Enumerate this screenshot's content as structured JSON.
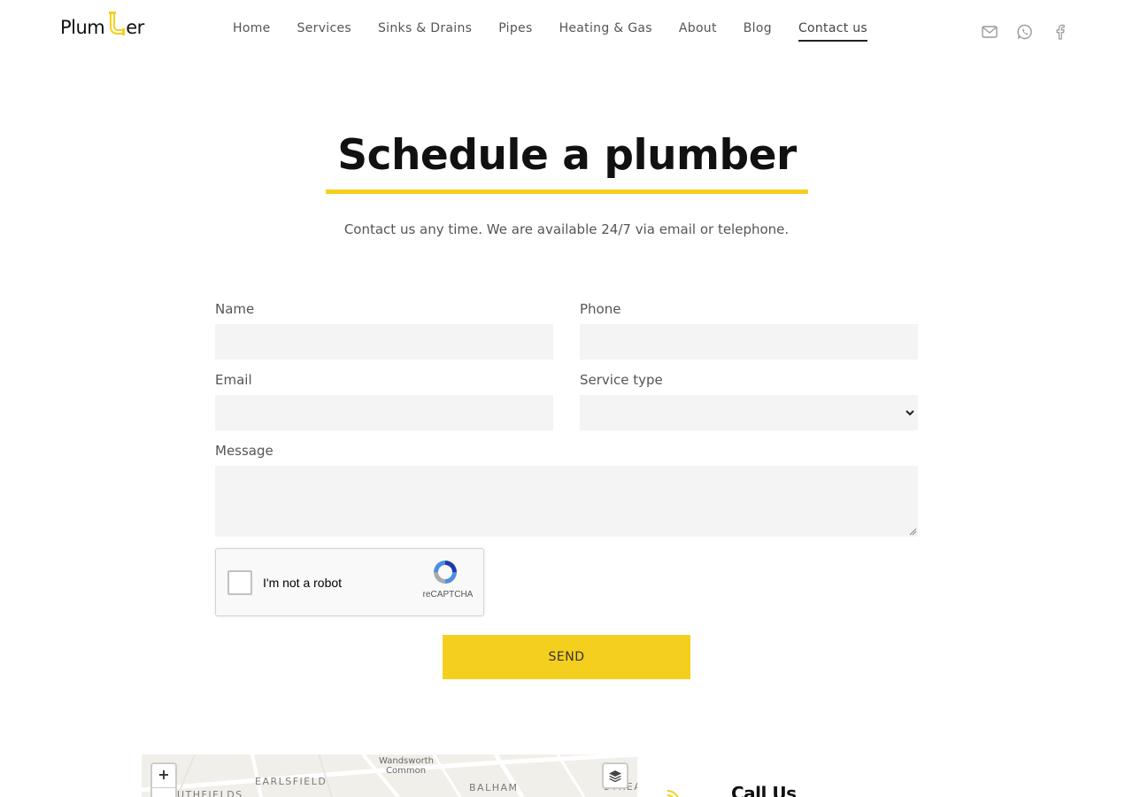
{
  "header": {
    "logo": {
      "prefix": "Plum",
      "suffix": "er"
    },
    "nav": [
      {
        "label": "Home",
        "active": false
      },
      {
        "label": "Services",
        "active": false
      },
      {
        "label": "Sinks & Drains",
        "active": false
      },
      {
        "label": "Pipes",
        "active": false
      },
      {
        "label": "Heating & Gas",
        "active": false
      },
      {
        "label": "About",
        "active": false
      },
      {
        "label": "Blog",
        "active": false
      },
      {
        "label": "Contact us",
        "active": true
      }
    ],
    "social_icons": [
      "email-icon",
      "whatsapp-icon",
      "facebook-icon"
    ]
  },
  "hero": {
    "title": "Schedule a plumber",
    "subtitle": "Contact us any time. We are available 24/7 via email or telephone."
  },
  "form": {
    "name_label": "Name",
    "name_value": "",
    "phone_label": "Phone",
    "phone_value": "",
    "email_label": "Email",
    "email_value": "",
    "service_label": "Service type",
    "service_value": "",
    "message_label": "Message",
    "message_value": "",
    "recaptcha_label": "I'm not a robot",
    "recaptcha_brand": "reCAPTCHA",
    "send_label": "SEND"
  },
  "map": {
    "labels": [
      "EARLSFIELD",
      "BALHAM",
      "Wandsworth",
      "Common",
      "UTHFIELDS",
      "STREA"
    ],
    "zoom_in": "+",
    "zoom_out": "−"
  },
  "contact": {
    "call_title": "Call Us"
  },
  "colors": {
    "accent": "#f5cf1e",
    "text_dark": "#111111",
    "text_muted": "#555555",
    "input_bg": "#f4f4f4"
  }
}
